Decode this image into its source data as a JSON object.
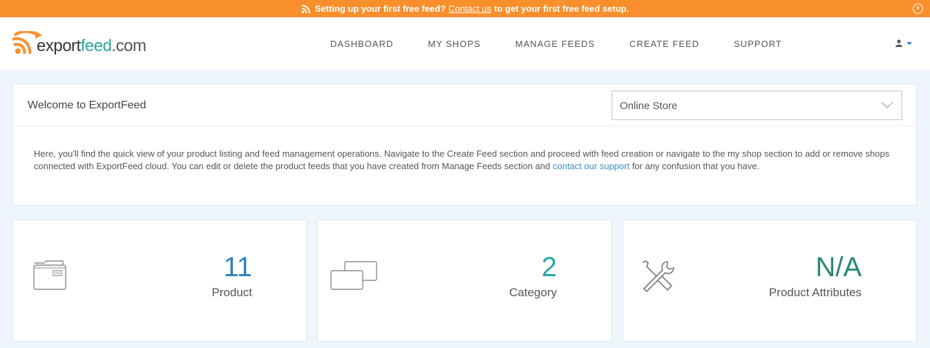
{
  "banner": {
    "text_before": "Setting up your first free feed?",
    "link": "Contact us",
    "text_after": "to get your first free feed setup.",
    "icon": "rss-icon",
    "close_icon": "close-icon"
  },
  "logo": {
    "part1": "export",
    "part2": "feed",
    "part3": ".com"
  },
  "nav": [
    "DASHBOARD",
    "MY SHOPS",
    "MANAGE FEEDS",
    "CREATE FEED",
    "SUPPORT"
  ],
  "user_menu": {
    "icon": "user-icon"
  },
  "welcome": {
    "title": "Welcome to ExportFeed",
    "store_select": {
      "value": "Online Store"
    },
    "body_text": "Here, you'll find the quick view of your product listing and feed management operations. Navigate to the Create Feed section and proceed with feed creation or navigate to the my shop section to add or remove shops connected with ExportFeed cloud. You can edit or delete the product feeds that you have created from Manage Feeds section and",
    "body_link": "contact our support",
    "body_after": "for any confusion that you have."
  },
  "stats": [
    {
      "value": "11",
      "label": "Product",
      "icon": "folder-icon",
      "color": "#2f83b7"
    },
    {
      "value": "2",
      "label": "Category",
      "icon": "cards-icon",
      "color": "#2ba6a8"
    },
    {
      "value": "N/A",
      "label": "Product Attributes",
      "icon": "tools-icon",
      "color": "#2a8a72"
    }
  ],
  "colors": {
    "banner": "#f98f2b",
    "accent": "#2aa7a0",
    "link": "#3a8fc0"
  }
}
